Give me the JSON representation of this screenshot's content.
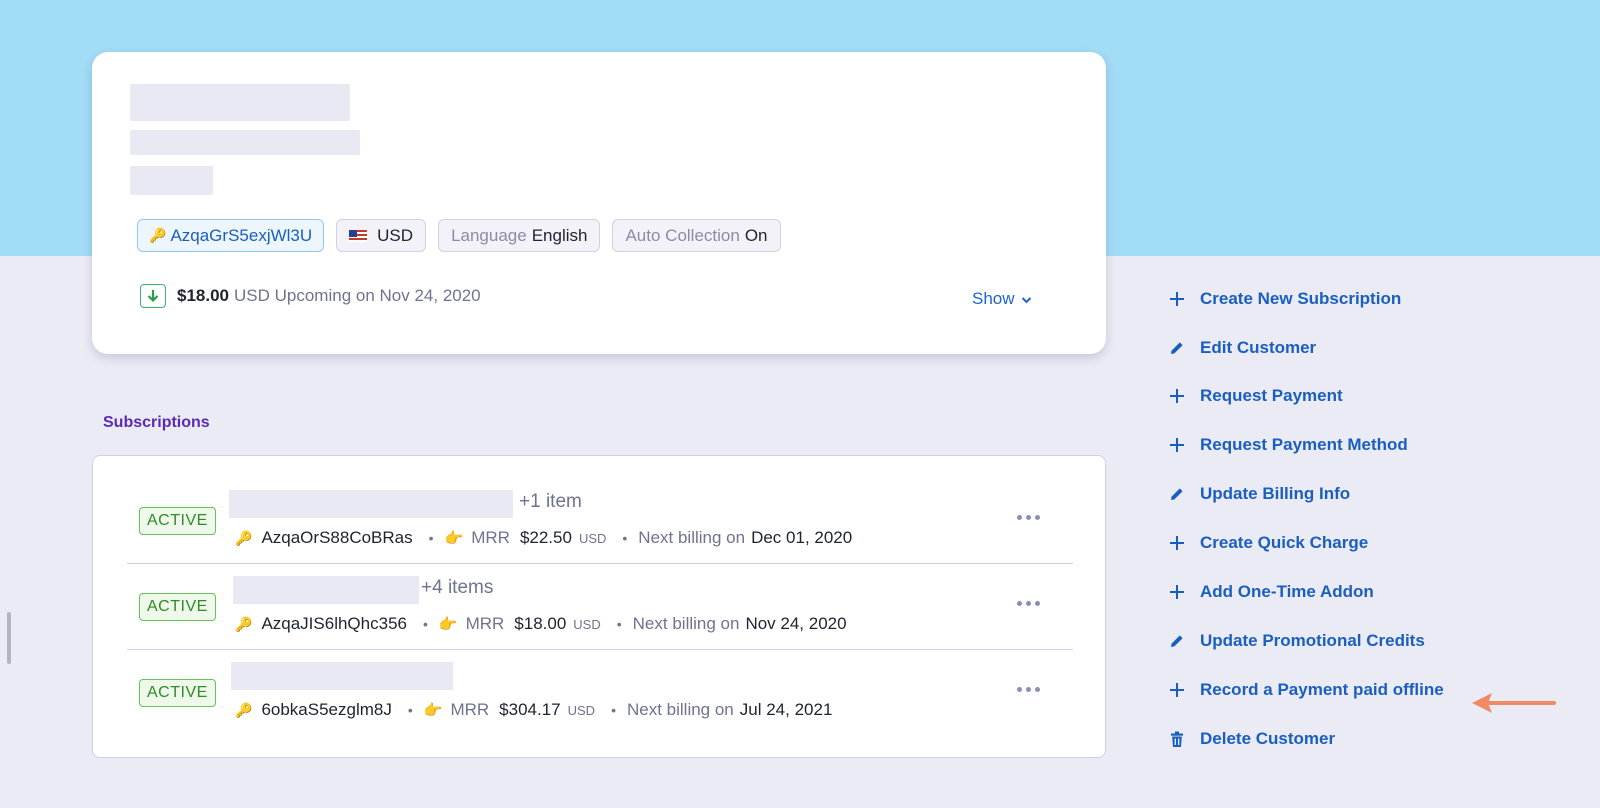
{
  "customer": {
    "chips": {
      "id": "AzqaGrS5exjWl3U",
      "currency": "USD",
      "language_label": "Language",
      "language_value": "English",
      "auto_collection_label": "Auto Collection",
      "auto_collection_value": "On"
    },
    "upcoming": {
      "amount": "$18.00",
      "text": "USD Upcoming on Nov 24, 2020",
      "show_label": "Show"
    }
  },
  "subscriptions": {
    "heading": "Subscriptions",
    "rows": [
      {
        "status": "ACTIVE",
        "item_count": "+1 item",
        "id": "AzqaOrS88CoBRas",
        "mrr_label": "MRR",
        "mrr": "$22.50",
        "currency": "USD",
        "next_billing_label": "Next billing on",
        "next_billing": "Dec 01, 2020"
      },
      {
        "status": "ACTIVE",
        "item_count": "+4 items",
        "id": "AzqaJIS6lhQhc356",
        "mrr_label": "MRR",
        "mrr": "$18.00",
        "currency": "USD",
        "next_billing_label": "Next billing on",
        "next_billing": "Nov 24, 2020"
      },
      {
        "status": "ACTIVE",
        "item_count": "",
        "id": "6obkaS5ezglm8J",
        "mrr_label": "MRR",
        "mrr": "$304.17",
        "currency": "USD",
        "next_billing_label": "Next billing on",
        "next_billing": "Jul 24, 2021"
      }
    ]
  },
  "actions": [
    {
      "label": "Create New Subscription",
      "icon": "plus-icon"
    },
    {
      "label": "Edit Customer",
      "icon": "pencil-icon"
    },
    {
      "label": "Request Payment",
      "icon": "plus-icon"
    },
    {
      "label": "Request Payment Method",
      "icon": "plus-icon"
    },
    {
      "label": "Update Billing Info",
      "icon": "pencil-icon"
    },
    {
      "label": "Create Quick Charge",
      "icon": "plus-icon"
    },
    {
      "label": "Add One-Time Addon",
      "icon": "plus-icon"
    },
    {
      "label": "Update Promotional Credits",
      "icon": "pencil-icon"
    },
    {
      "label": "Record a Payment paid offline",
      "icon": "plus-icon"
    },
    {
      "label": "Delete Customer",
      "icon": "trash-icon"
    }
  ],
  "colors": {
    "top_band": "#a3dcf6",
    "background": "#ebebf5",
    "action_blue": "#1a5fbf",
    "active_green": "#2e8a2a",
    "heading_purple": "#5b2ab3",
    "arrow": "#f08a66"
  }
}
